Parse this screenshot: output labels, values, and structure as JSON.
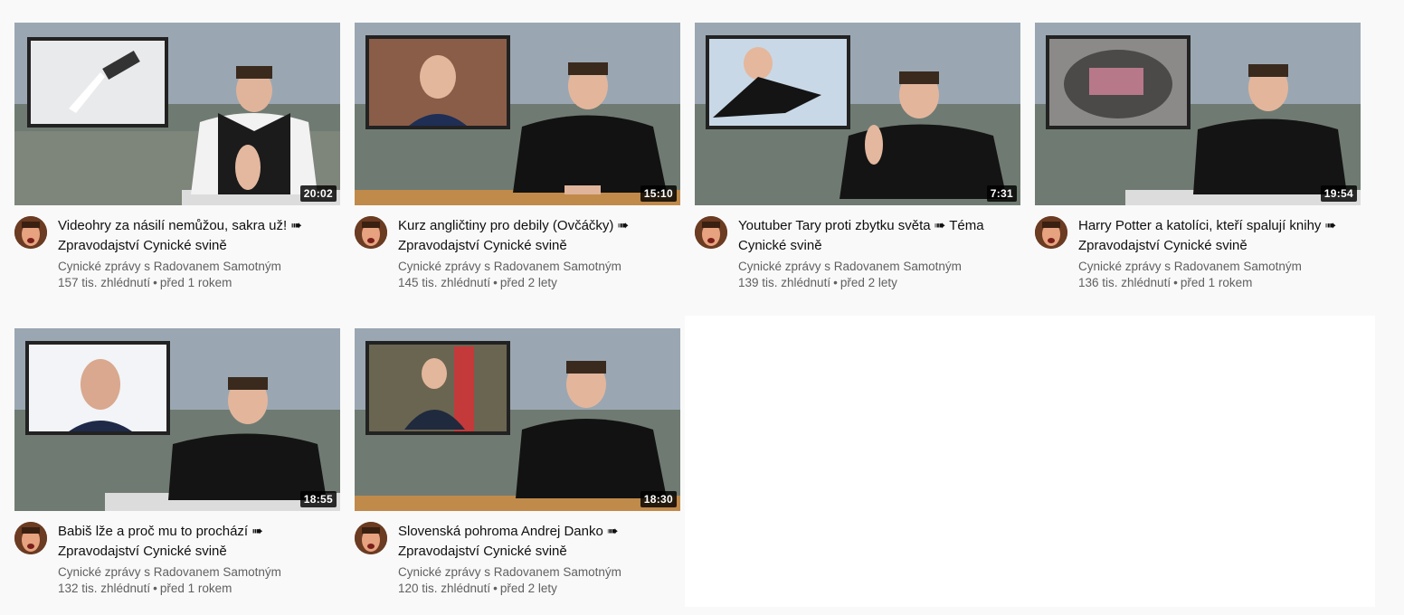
{
  "colors": {
    "accent": "#0f0f0f",
    "secondary_text": "#606060",
    "duration_bg": "#000000"
  },
  "videos": [
    {
      "title": "Videohry za násilí nemůžou, sakra už! ➠ Zpravodajství Cynické svině",
      "channel": "Cynické zprávy s Radovanem Samotným",
      "views": "157 tis. zhlédnutí",
      "age": "před 1 rokem",
      "duration": "20:02"
    },
    {
      "title": "Kurz angličtiny pro debily (Ovčáčky) ➠ Zpravodajství Cynické svině",
      "channel": "Cynické zprávy s Radovanem Samotným",
      "views": "145 tis. zhlédnutí",
      "age": "před 2 lety",
      "duration": "15:10"
    },
    {
      "title": "Youtuber Tary proti zbytku světa ➠ Téma Cynické svině",
      "channel": "Cynické zprávy s Radovanem Samotným",
      "views": "139 tis. zhlédnutí",
      "age": "před 2 lety",
      "duration": "7:31"
    },
    {
      "title": "Harry Potter a katolíci, kteří spalují knihy ➠ Zpravodajství Cynické svině",
      "channel": "Cynické zprávy s Radovanem Samotným",
      "views": "136 tis. zhlédnutí",
      "age": "před 1 rokem",
      "duration": "19:54"
    },
    {
      "title": "Babiš lže a proč mu to prochází ➠ Zpravodajství Cynické svině",
      "channel": "Cynické zprávy s Radovanem Samotným",
      "views": "132 tis. zhlédnutí",
      "age": "před 1 rokem",
      "duration": "18:55"
    },
    {
      "title": "Slovenská pohroma Andrej Danko ➠ Zpravodajství Cynické svině",
      "channel": "Cynické zprávy s Radovanem Samotným",
      "views": "120 tis. zhlédnutí",
      "age": "před 2 lety",
      "duration": "18:30"
    }
  ]
}
